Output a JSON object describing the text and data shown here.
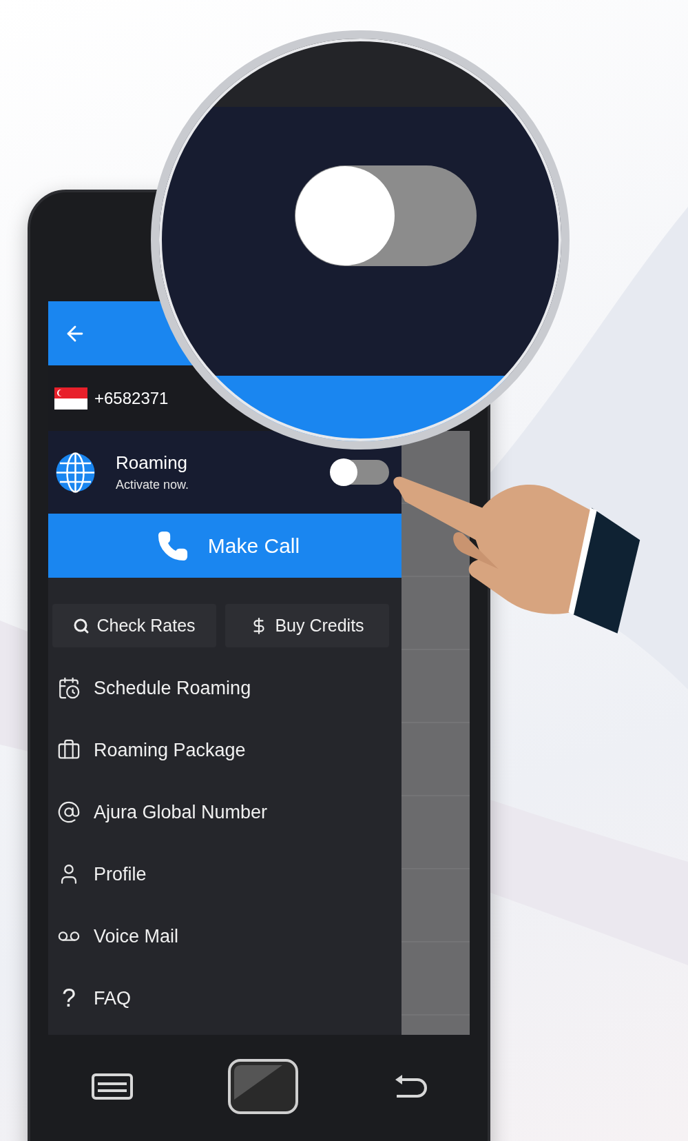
{
  "account": {
    "number": "+6582371"
  },
  "roaming": {
    "title": "Roaming",
    "subtitle": "Activate now.",
    "on": false
  },
  "make_call": {
    "label": "Make Call"
  },
  "quick_actions": [
    {
      "kind": "search",
      "label": "Check Rates"
    },
    {
      "kind": "dollar",
      "label": "Buy Credits"
    }
  ],
  "menu": [
    {
      "kind": "schedule",
      "label": "Schedule Roaming"
    },
    {
      "kind": "package",
      "label": "Roaming Package"
    },
    {
      "kind": "global",
      "label": "Ajura Global Number"
    },
    {
      "kind": "profile",
      "label": "Profile"
    },
    {
      "kind": "voicemail",
      "label": "Voice Mail"
    },
    {
      "kind": "faq",
      "glyph": "?",
      "label": "FAQ"
    }
  ]
}
